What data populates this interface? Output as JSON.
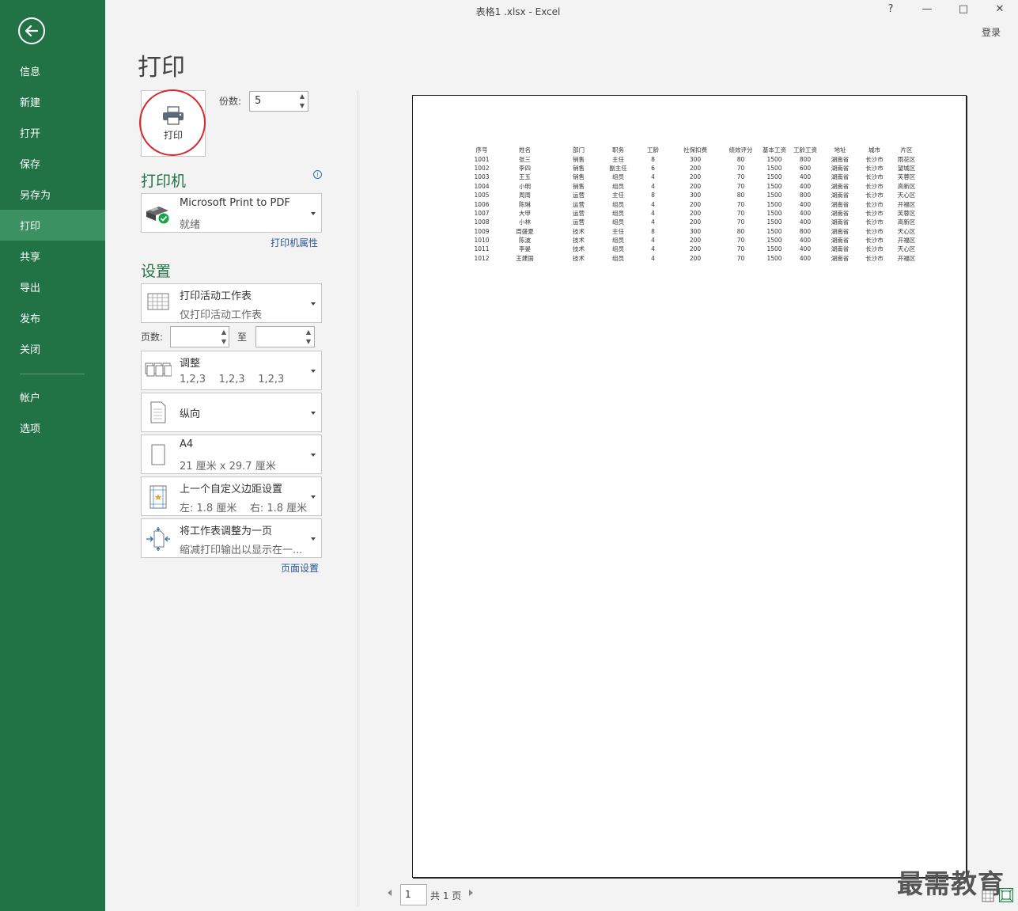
{
  "window": {
    "title": "表格1 .xlsx - Excel",
    "help": "?",
    "minimize": "—",
    "maximize": "□",
    "close": "✕",
    "login": "登录"
  },
  "sidebar": {
    "back_icon": "back-arrow-icon",
    "items": [
      {
        "label": "信息"
      },
      {
        "label": "新建"
      },
      {
        "label": "打开"
      },
      {
        "label": "保存"
      },
      {
        "label": "另存为"
      },
      {
        "label": "打印",
        "active": true
      },
      {
        "label": "共享"
      },
      {
        "label": "导出"
      },
      {
        "label": "发布"
      },
      {
        "label": "关闭"
      },
      {
        "label": "帐户"
      },
      {
        "label": "选项"
      }
    ],
    "active_color": "#3c9162",
    "bg_color": "#217346"
  },
  "header": {
    "title": "打印"
  },
  "print_button": {
    "label": "打印",
    "icon": "printer-icon"
  },
  "copies": {
    "label": "份数:",
    "value": "5"
  },
  "printer": {
    "section_title": "打印机",
    "name": "Microsoft Print to PDF",
    "status": "就绪",
    "properties_link": "打印机属性",
    "info_icon": "i"
  },
  "settings": {
    "section_title": "设置",
    "scope": {
      "main": "打印活动工作表",
      "sub": "仅打印活动工作表"
    },
    "pages_label": "页数:",
    "to_label": "至",
    "collate": {
      "main": "调整",
      "sub": "1,2,3    1,2,3    1,2,3"
    },
    "orientation": {
      "main": "纵向"
    },
    "paper": {
      "main": "A4",
      "sub": "21 厘米 x 29.7 厘米"
    },
    "margins": {
      "main": "上一个自定义边距设置",
      "sub": "左: 1.8 厘米    右: 1.8 厘米"
    },
    "scaling": {
      "main": "将工作表调整为一页",
      "sub": "缩减打印输出以显示在一..."
    },
    "page_setup_link": "页面设置"
  },
  "preview": {
    "headers": [
      "序号",
      "姓名",
      "部门",
      "职务",
      "工龄",
      "社保扣费",
      "绩效评分",
      "基本工资",
      "工龄工资",
      "地址",
      "城市",
      "片区"
    ],
    "rows": [
      [
        "1001",
        "张三",
        "销售",
        "主任",
        "8",
        "300",
        "80",
        "1500",
        "800",
        "湖南省",
        "长沙市",
        "雨花区"
      ],
      [
        "1002",
        "李四",
        "销售",
        "副主任",
        "6",
        "200",
        "70",
        "1500",
        "600",
        "湖南省",
        "长沙市",
        "望城区"
      ],
      [
        "1003",
        "王五",
        "销售",
        "组员",
        "4",
        "200",
        "70",
        "1500",
        "400",
        "湖南省",
        "长沙市",
        "芙蓉区"
      ],
      [
        "1004",
        "小明",
        "销售",
        "组员",
        "4",
        "200",
        "70",
        "1500",
        "400",
        "湖南省",
        "长沙市",
        "高新区"
      ],
      [
        "1005",
        "周周",
        "运营",
        "主任",
        "8",
        "300",
        "80",
        "1500",
        "800",
        "湖南省",
        "长沙市",
        "天心区"
      ],
      [
        "1006",
        "陈琳",
        "运营",
        "组员",
        "4",
        "200",
        "70",
        "1500",
        "400",
        "湖南省",
        "长沙市",
        "开福区"
      ],
      [
        "1007",
        "大甲",
        "运营",
        "组员",
        "4",
        "200",
        "70",
        "1500",
        "400",
        "湖南省",
        "长沙市",
        "芙蓉区"
      ],
      [
        "1008",
        "小林",
        "运营",
        "组员",
        "4",
        "200",
        "70",
        "1500",
        "400",
        "湖南省",
        "长沙市",
        "高新区"
      ],
      [
        "1009",
        "周盛夏",
        "技术",
        "主任",
        "8",
        "300",
        "80",
        "1500",
        "800",
        "湖南省",
        "长沙市",
        "天心区"
      ],
      [
        "1010",
        "陈波",
        "技术",
        "组员",
        "4",
        "200",
        "70",
        "1500",
        "400",
        "湖南省",
        "长沙市",
        "开福区"
      ],
      [
        "1011",
        "李晏",
        "技术",
        "组员",
        "4",
        "200",
        "70",
        "1500",
        "400",
        "湖南省",
        "长沙市",
        "天心区"
      ],
      [
        "1012",
        "王建国",
        "技术",
        "组员",
        "4",
        "200",
        "70",
        "1500",
        "400",
        "湖南省",
        "长沙市",
        "开福区"
      ]
    ]
  },
  "page_nav": {
    "current": "1",
    "total": "共 1 页"
  },
  "watermark": "最需教育"
}
